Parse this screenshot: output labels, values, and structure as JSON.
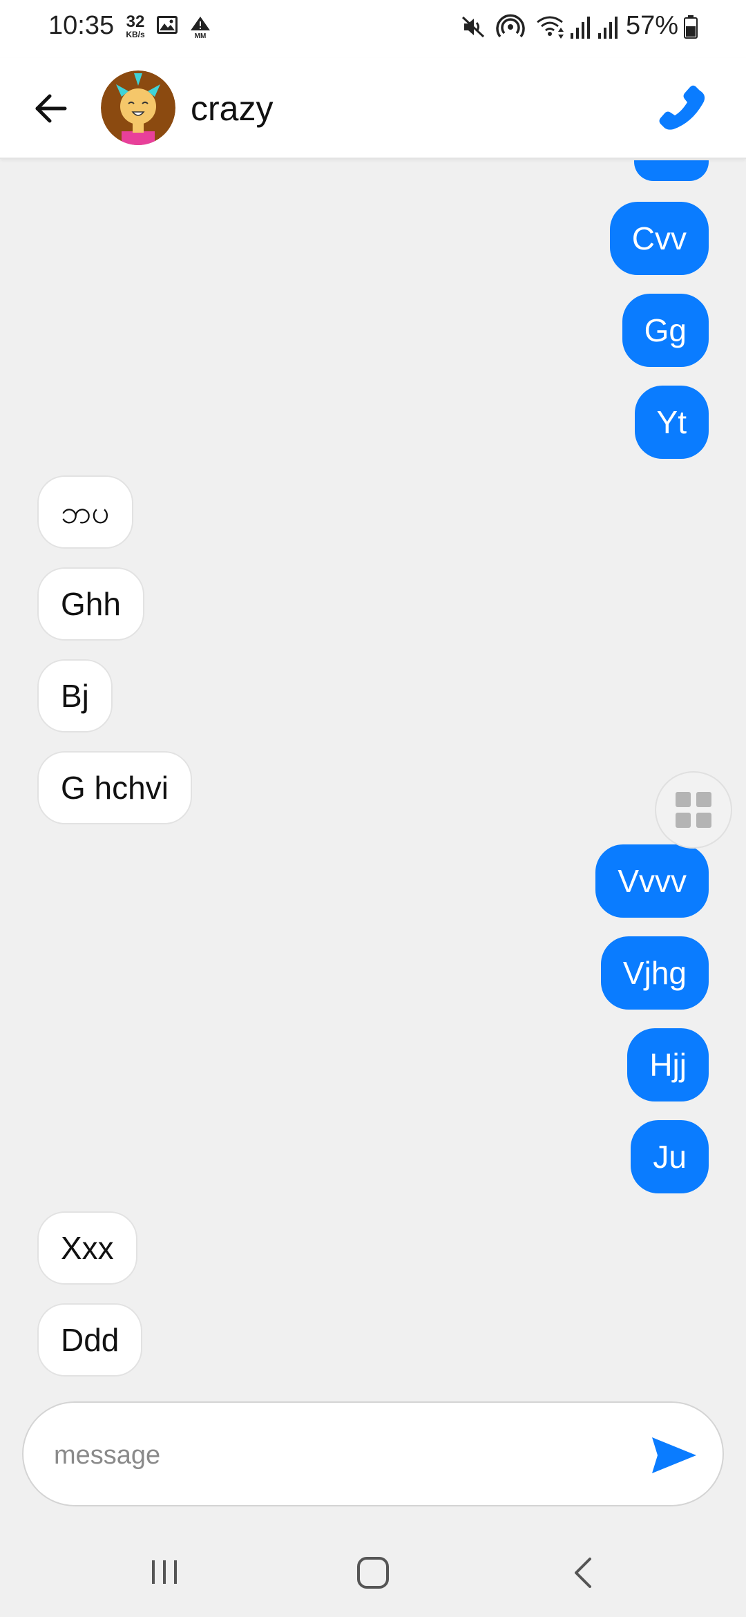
{
  "status_bar": {
    "time": "10:35",
    "net_speed_value": "32",
    "net_speed_unit": "KB/s",
    "alert_badge": "MM",
    "battery_percent": "57%",
    "icons": [
      "gallery-icon",
      "alert-icon",
      "mute-icon",
      "hotspot-icon",
      "wifi-icon",
      "signal-icon",
      "signal-icon",
      "battery-icon"
    ]
  },
  "header": {
    "contact_name": "crazy",
    "icons": [
      "back-arrow-icon",
      "avatar",
      "phone-icon"
    ],
    "accent_color": "#0a7cff"
  },
  "messages": [
    {
      "direction": "out",
      "text": "Cvv"
    },
    {
      "direction": "out",
      "text": "Gg"
    },
    {
      "direction": "out",
      "text": "Yt"
    },
    {
      "direction": "in",
      "text": "ဘပ"
    },
    {
      "direction": "in",
      "text": "Ghh"
    },
    {
      "direction": "in",
      "text": "Bj"
    },
    {
      "direction": "in",
      "text": "G hchvi"
    },
    {
      "direction": "out",
      "text": "Vvvv"
    },
    {
      "direction": "out",
      "text": "Vjhg"
    },
    {
      "direction": "out",
      "text": "Hjj"
    },
    {
      "direction": "out",
      "text": "Ju"
    },
    {
      "direction": "in",
      "text": "Xxx"
    },
    {
      "direction": "in",
      "text": "Ddd"
    }
  ],
  "composer": {
    "placeholder": "message",
    "value": "",
    "send_icon": "send-icon"
  },
  "navigation": {
    "icons": [
      "recents-icon",
      "home-icon",
      "back-icon"
    ]
  },
  "colors": {
    "outgoing_bubble": "#0a7cff",
    "incoming_bubble": "#ffffff",
    "background": "#f0f0f0"
  }
}
